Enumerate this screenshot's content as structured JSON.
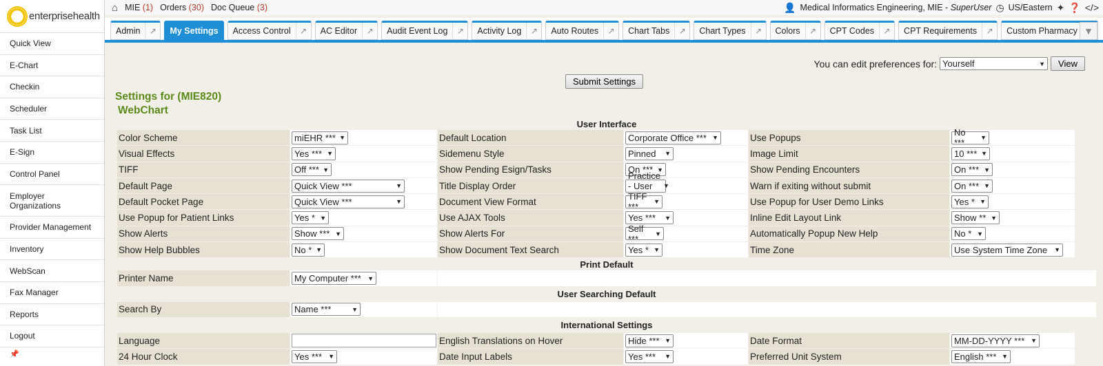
{
  "brand": {
    "logo_text": "enterprisehealth"
  },
  "sidebar": {
    "items": [
      "Quick View",
      "E-Chart",
      "Checkin",
      "Scheduler",
      "Task List",
      "E-Sign",
      "Control Panel",
      "Employer Organizations",
      "Provider Management",
      "Inventory",
      "WebScan",
      "Fax Manager",
      "Reports",
      "Logout"
    ]
  },
  "topbar": {
    "mie_label": "MIE",
    "mie_count": "(1)",
    "orders_label": "Orders",
    "orders_count": "(30)",
    "docq_label": "Doc Queue",
    "docq_count": "(3)",
    "user_org": "Medical Informatics Engineering, MIE -",
    "user_role": "SuperUser",
    "timezone": "US/Eastern"
  },
  "tabs": [
    {
      "label": "Admin",
      "active": false
    },
    {
      "label": "My Settings",
      "active": true
    },
    {
      "label": "Access Control",
      "active": false
    },
    {
      "label": "AC Editor",
      "active": false
    },
    {
      "label": "Audit Event Log",
      "active": false
    },
    {
      "label": "Activity Log",
      "active": false
    },
    {
      "label": "Auto Routes",
      "active": false
    },
    {
      "label": "Chart Tabs",
      "active": false
    },
    {
      "label": "Chart Types",
      "active": false
    },
    {
      "label": "Colors",
      "active": false
    },
    {
      "label": "CPT Codes",
      "active": false
    },
    {
      "label": "CPT Requirements",
      "active": false
    },
    {
      "label": "Custom Pharmacy",
      "active": false
    }
  ],
  "prefs": {
    "label": "You can edit preferences for:",
    "value": "Yourself",
    "view_button": "View"
  },
  "submit_label": "Submit Settings",
  "settings_title": "Settings for (MIE820)",
  "webchart_title": "WebChart",
  "sections": {
    "user_interface": "User Interface",
    "print_default": "Print Default",
    "user_searching": "User Searching Default",
    "international": "International Settings"
  },
  "ui_rows": [
    [
      "Color Scheme",
      "miEHR ***",
      "Default Location",
      "Corporate Office ***",
      "Use Popups",
      "No ***"
    ],
    [
      "Visual Effects",
      "Yes ***",
      "Sidemenu Style",
      "Pinned",
      "Image Limit",
      "10 ***"
    ],
    [
      "TIFF",
      "Off ***",
      "Show Pending Esign/Tasks",
      "On ***",
      "Show Pending Encounters",
      "On ***"
    ],
    [
      "Default Page",
      "Quick View ***",
      "Title Display Order",
      "Practice - User ***",
      "Warn if exiting without submit",
      "On ***"
    ],
    [
      "Default Pocket Page",
      "Quick View ***",
      "Document View Format",
      "TIFF ***",
      "Use Popup for User Demo Links",
      "Yes *"
    ],
    [
      "Use Popup for Patient Links",
      "Yes *",
      "Use AJAX Tools",
      "Yes ***",
      "Inline Edit Layout Link",
      "Show **"
    ],
    [
      "Show Alerts",
      "Show ***",
      "Show Alerts For",
      "Self ***",
      "Automatically Popup New Help",
      "No *"
    ],
    [
      "Show Help Bubbles",
      "No *",
      "Show Document Text Search",
      "Yes *",
      "Time Zone",
      "Use System Time Zone"
    ]
  ],
  "ui_widths": [
    [
      82,
      64,
      139,
      55
    ],
    [
      64,
      99,
      70,
      56
    ],
    [
      58,
      60,
      59,
      60
    ],
    [
      164,
      130,
      59,
      60
    ],
    [
      164,
      70,
      54,
      54
    ],
    [
      54,
      64,
      70,
      70
    ],
    [
      76,
      68,
      56,
      50
    ],
    [
      48,
      54,
      54,
      162
    ]
  ],
  "printer": {
    "label": "Printer Name",
    "value": "My Computer ***"
  },
  "search": {
    "label": "Search By",
    "value": "Name ***"
  },
  "intl_rows": [
    [
      "Language",
      "",
      "English Translations on Hover",
      "Hide ***",
      "Date Format",
      "MM-DD-YYYY ***"
    ],
    [
      "24 Hour Clock",
      "Yes ***",
      "Date Input Labels",
      "Yes ***",
      "Preferred Unit System",
      "English ***"
    ]
  ]
}
